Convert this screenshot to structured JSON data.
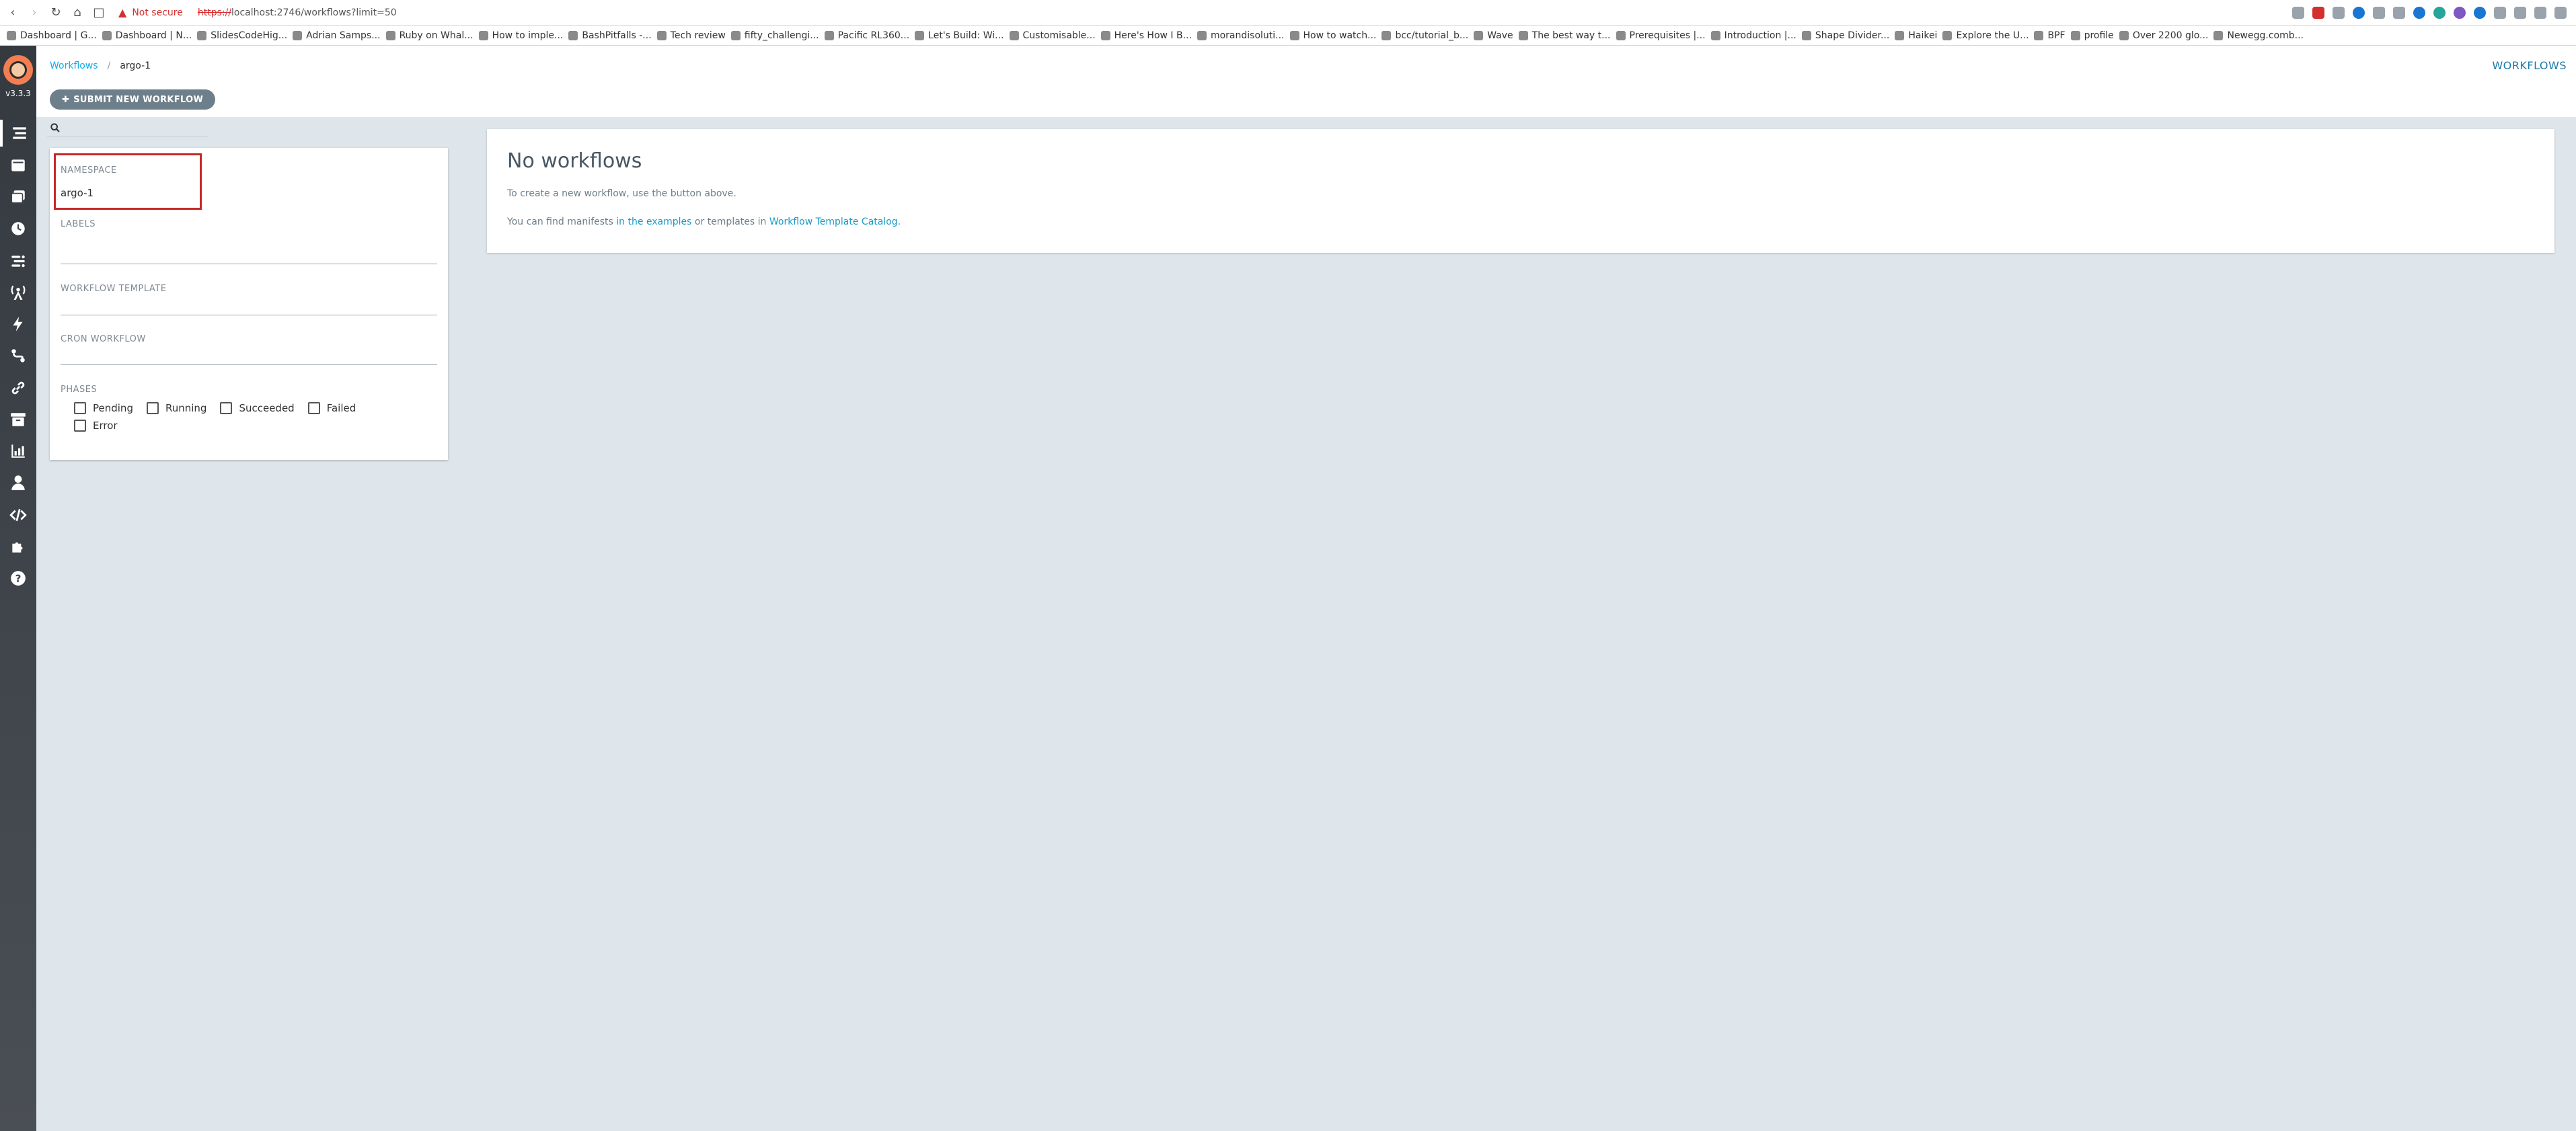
{
  "browser": {
    "security": "Not secure",
    "url_scheme": "https://",
    "url_rest": "localhost:2746/workflows?limit=50",
    "bookmarks": [
      "Dashboard | G...",
      "Dashboard | N...",
      "SlidesCodeHig...",
      "Adrian Samps...",
      "Ruby on Whal...",
      "How to imple...",
      "BashPitfalls -...",
      "Tech review",
      "fifty_challengi...",
      "Pacific RL360...",
      "Let's Build: Wi...",
      "Customisable...",
      "Here's How I B...",
      "morandisoluti...",
      "How to watch...",
      "bcc/tutorial_b...",
      "Wave",
      "The best way t...",
      "Prerequisites |...",
      "Introduction |...",
      "Shape Divider...",
      "Haikei",
      "Explore the U...",
      "BPF",
      "profile",
      "Over 2200 glo...",
      "Newegg.comb..."
    ]
  },
  "sidebar": {
    "version": "v3.3.3",
    "items": [
      {
        "icon": "workflows-icon"
      },
      {
        "icon": "workflow-templates-icon"
      },
      {
        "icon": "cluster-templates-icon"
      },
      {
        "icon": "cron-workflows-icon"
      },
      {
        "icon": "event-flow-icon"
      },
      {
        "icon": "event-sources-icon"
      },
      {
        "icon": "sensors-icon"
      },
      {
        "icon": "event-flow-alt-icon"
      },
      {
        "icon": "link-icon"
      },
      {
        "icon": "archive-icon"
      },
      {
        "icon": "reports-icon"
      },
      {
        "icon": "user-icon"
      },
      {
        "icon": "api-docs-icon"
      },
      {
        "icon": "plugins-icon"
      },
      {
        "icon": "help-icon"
      }
    ]
  },
  "header": {
    "breadcrumb_root": "Workflows",
    "breadcrumb_current": "argo-1",
    "title": "WORKFLOWS",
    "submit_label": "SUBMIT NEW WORKFLOW"
  },
  "filters": {
    "namespace_label": "NAMESPACE",
    "namespace_value": "argo-1",
    "labels_label": "LABELS",
    "template_label": "WORKFLOW TEMPLATE",
    "cron_label": "CRON WORKFLOW",
    "phases_label": "PHASES",
    "phases": [
      "Pending",
      "Running",
      "Succeeded",
      "Failed",
      "Error"
    ]
  },
  "main": {
    "title": "No workflows",
    "line1": "To create a new workflow, use the button above.",
    "line2_prefix": "You can find manifests ",
    "line2_link1": "in the examples",
    "line2_mid": " or templates in ",
    "line2_link2": "Workflow Template Catalog",
    "line2_suffix": "."
  },
  "colors": {
    "accent": "#0dadea",
    "highlight": "#c62828",
    "sidebar": "#343a40",
    "background": "#dee6eb"
  }
}
